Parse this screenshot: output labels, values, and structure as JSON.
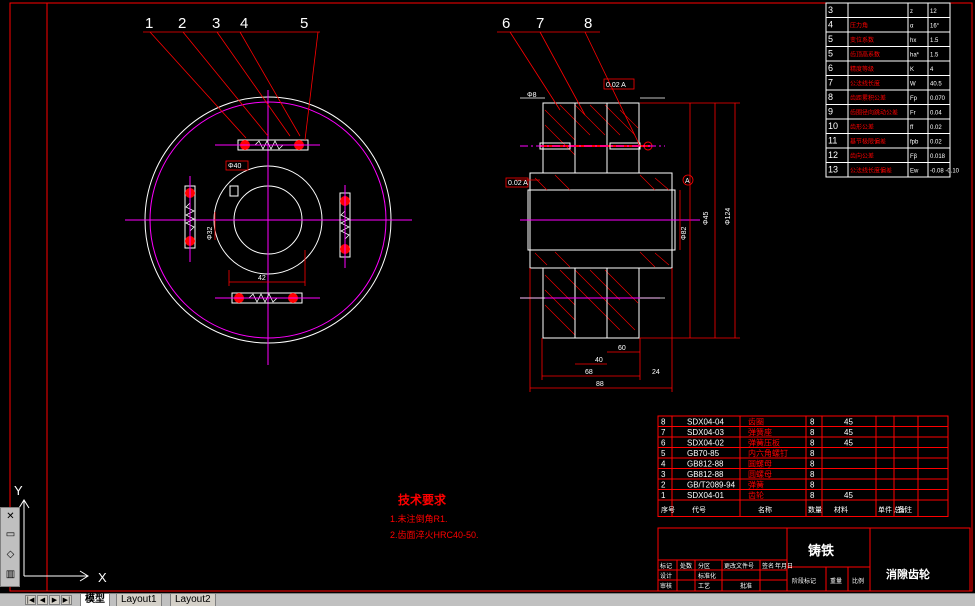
{
  "balloons": [
    "1",
    "2",
    "3",
    "4",
    "5",
    "6",
    "7",
    "8"
  ],
  "param_table": {
    "rows": [
      {
        "no": "3",
        "name": "",
        "sym": "z",
        "val": "12"
      },
      {
        "no": "4",
        "name": "压力角",
        "sym": "α",
        "val": "16°"
      },
      {
        "no": "5",
        "name": "变位系数",
        "sym": "hx",
        "val": "1.5"
      },
      {
        "no": "5",
        "name": "齿顶高系数",
        "sym": "ha*",
        "val": "1.5"
      },
      {
        "no": "6",
        "name": "精度等级",
        "sym": "K",
        "val": "4"
      },
      {
        "no": "7",
        "name": "公法线长度",
        "sym": "W",
        "val": "40.5"
      },
      {
        "no": "8",
        "name": "齿距累积公差",
        "sym": "Fp",
        "val": "0.070"
      },
      {
        "no": "9",
        "name": "齿圈径向跳动公差",
        "sym": "Fr",
        "val": "0.04"
      },
      {
        "no": "10",
        "name": "齿形公差",
        "sym": "ff",
        "val": "0.02"
      },
      {
        "no": "11",
        "name": "基节极限偏差",
        "sym": "fpb",
        "val": "0.02"
      },
      {
        "no": "12",
        "name": "齿向公差",
        "sym": "Fβ",
        "val": "0.018"
      },
      {
        "no": "13",
        "name": "公法线长度偏差",
        "sym": "Ew",
        "val": "-0.08 -0.10"
      }
    ]
  },
  "dims": {
    "gear_left_top": "Φ8",
    "right_d1": "Φ45",
    "right_d2": "Φ124",
    "right_d3": "Φ82",
    "bottom_w1": "40",
    "bottom_w2": "60",
    "bottom_w3": "68",
    "bottom_total": "88",
    "bottom_small": "24",
    "left_bore": "Φ40",
    "keyway": "Φ32",
    "left_width": "42",
    "datum": "A",
    "tol_frame_top": "0.02 A",
    "tol_frame_left": "0.02 A"
  },
  "bom": {
    "rows": [
      {
        "no": "8",
        "code": "SDX04-04",
        "name": "齿圈",
        "qty": "8",
        "mat": "45"
      },
      {
        "no": "7",
        "code": "SDX04-03",
        "name": "弹簧座",
        "qty": "8",
        "mat": "45"
      },
      {
        "no": "6",
        "code": "SDX04-02",
        "name": "弹簧压板",
        "qty": "8",
        "mat": "45"
      },
      {
        "no": "5",
        "code": "GB70-85",
        "name": "内六角螺钉",
        "qty": "8",
        "mat": ""
      },
      {
        "no": "4",
        "code": "GB812-88",
        "name": "圆螺母",
        "qty": "8",
        "mat": ""
      },
      {
        "no": "3",
        "code": "GB812-88",
        "name": "圆螺母",
        "qty": "8",
        "mat": ""
      },
      {
        "no": "2",
        "code": "GB/T2089-94",
        "name": "弹簧",
        "qty": "8",
        "mat": ""
      },
      {
        "no": "1",
        "code": "SDX04-01",
        "name": "齿轮",
        "qty": "8",
        "mat": "45"
      }
    ],
    "header": {
      "no": "序号",
      "code": "代号",
      "name": "名称",
      "qty": "数量",
      "mat": "材料",
      "note1": "单件 总计",
      "note2": "重量",
      "remark": "备注"
    }
  },
  "titleblock": {
    "material": "铸铁",
    "part_name": "消隙齿轮",
    "fields": [
      "标记",
      "处数",
      "分区",
      "更改文件号",
      "签名",
      "年月日",
      "设计",
      "标准化",
      "阶段标记",
      "重量",
      "比例",
      "审核",
      "工艺",
      "批准"
    ]
  },
  "tech_req": {
    "title": "技术要求",
    "lines": [
      "1.未注倒角R1.",
      "2.齿面淬火HRC40-50."
    ]
  },
  "ucs": {
    "x": "X",
    "y": "Y"
  },
  "tabs": [
    "模型",
    "Layout1",
    "Layout2"
  ],
  "colors": {
    "bg": "#000000",
    "red": "#ff0000",
    "magenta": "#ff00ff",
    "white": "#ffffff",
    "yellow": "#ffff00",
    "cyan": "#00ffff"
  }
}
